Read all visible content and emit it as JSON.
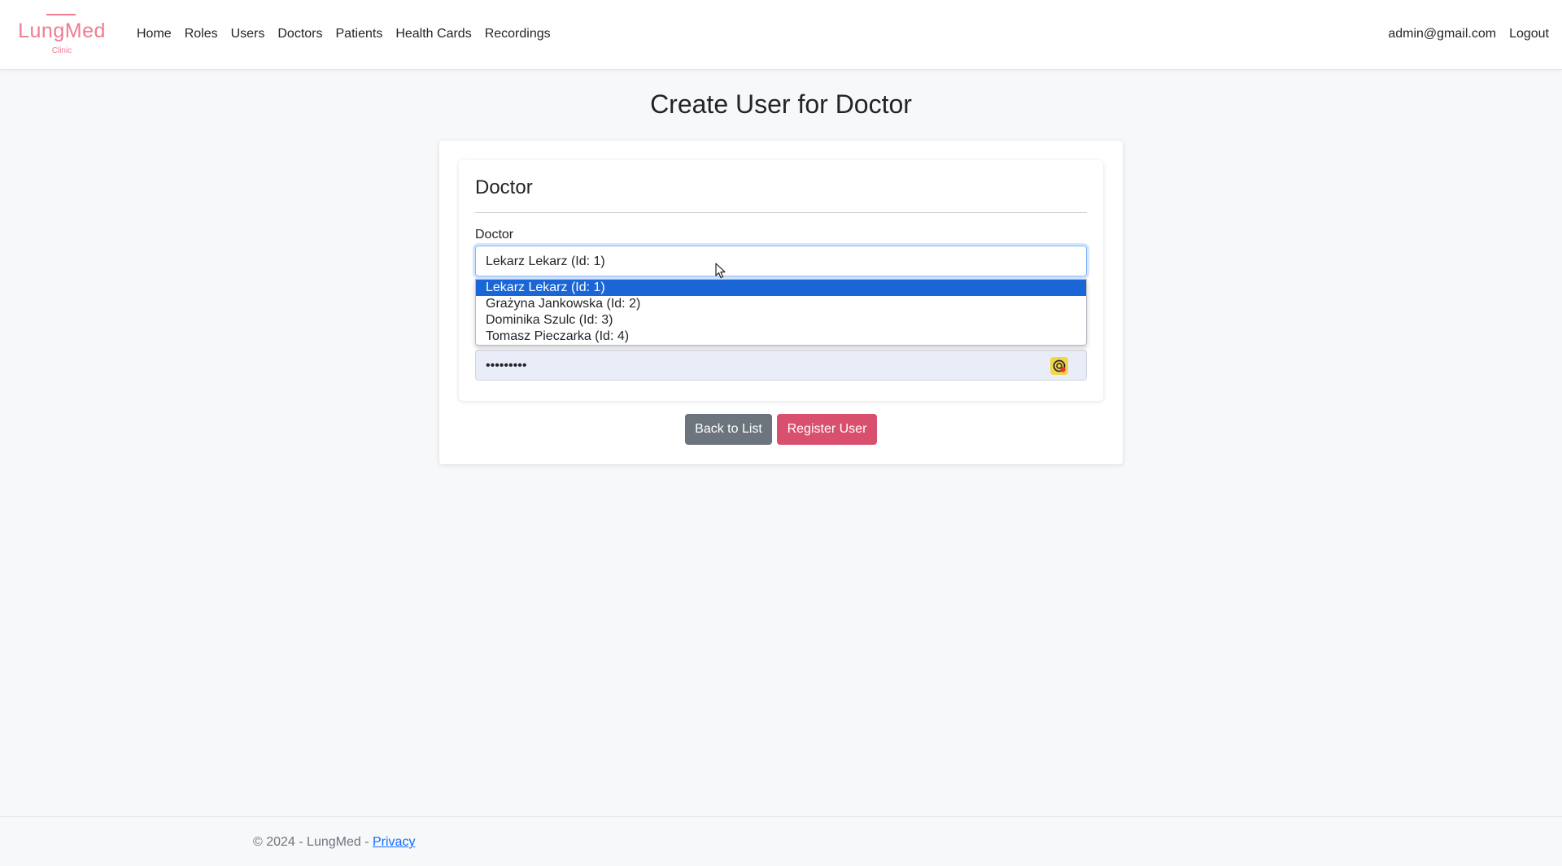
{
  "brand": {
    "name": "LungMed",
    "sub": "Clinic",
    "color": "#f07b93"
  },
  "nav": {
    "links": [
      "Home",
      "Roles",
      "Users",
      "Doctors",
      "Patients",
      "Health Cards",
      "Recordings"
    ],
    "user_email": "admin@gmail.com",
    "logout": "Logout"
  },
  "page": {
    "title": "Create User for Doctor"
  },
  "form": {
    "section_title": "Doctor",
    "doctor_label": "Doctor",
    "doctor_selected": "Lekarz Lekarz (Id: 1)",
    "doctor_options": [
      "Lekarz Lekarz (Id: 1)",
      "Grażyna Jankowska (Id: 2)",
      "Dominika Szulc (Id: 3)",
      "Tomasz Pieczarka (Id: 4)"
    ],
    "password_value": "•••••••••"
  },
  "buttons": {
    "back": "Back to List",
    "register": "Register User"
  },
  "footer": {
    "text": "© 2024 - LungMed - ",
    "privacy": "Privacy"
  },
  "colors": {
    "accent": "#d9506e",
    "selected_option": "#1a66d6",
    "secondary": "#6c757d"
  }
}
